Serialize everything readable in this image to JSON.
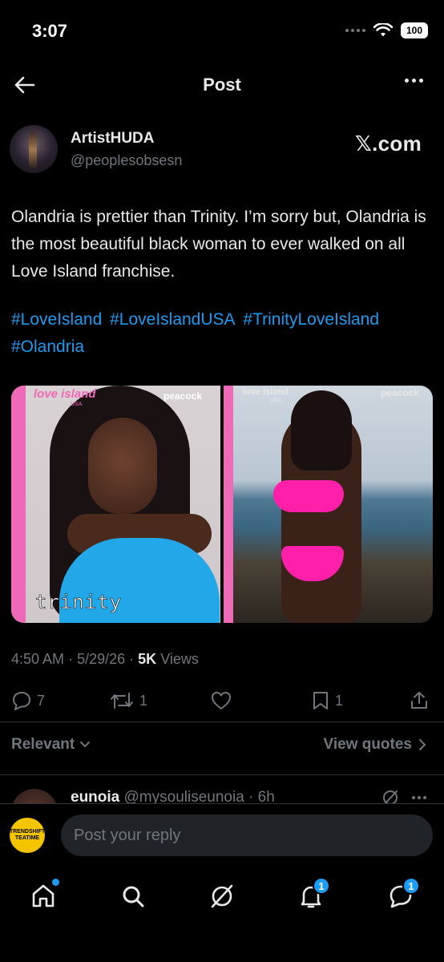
{
  "status": {
    "time": "3:07",
    "battery": "100"
  },
  "header": {
    "title": "Post"
  },
  "author": {
    "name": "ArtistHUDA",
    "handle": "@peoplesobsesn",
    "watermark": "𝕏.com"
  },
  "post": {
    "text": "Olandria is prettier than Trinity. I’m sorry but, Olandria is the most beautiful black woman to ever walked on all Love Island franchise.",
    "hashtags": [
      "#LoveIsland",
      "#LoveIslandUSA",
      "#TrinityLoveIsland",
      "#Olandria"
    ],
    "images": [
      {
        "brand": "love island",
        "brand_sub": "USA",
        "network": "peacock",
        "caption": "trinity"
      },
      {
        "brand": "love island",
        "brand_sub": "USA",
        "network": "peacock"
      }
    ]
  },
  "meta": {
    "time": "4:50 AM",
    "date": "5/29/26",
    "views_count": "5K",
    "views_label": "Views",
    "sep": "·"
  },
  "actions": {
    "replies": "7",
    "reposts": "1",
    "likes": "",
    "bookmarks": "1"
  },
  "sort": {
    "relevant_label": "Relevant",
    "view_quotes_label": "View quotes"
  },
  "reply_preview": {
    "name": "eunoia",
    "handle": "@mysouliseunoia",
    "time": "6h"
  },
  "reply_bar": {
    "placeholder": "Post your reply",
    "avatar_text": "TRENDSHIFT TEATIME"
  },
  "nav": {
    "notifications_badge": "1",
    "messages_badge": "1"
  },
  "colors": {
    "accent": "#1d9bf0",
    "background": "#000000",
    "muted": "#71767b",
    "text": "#e7e9ea"
  }
}
